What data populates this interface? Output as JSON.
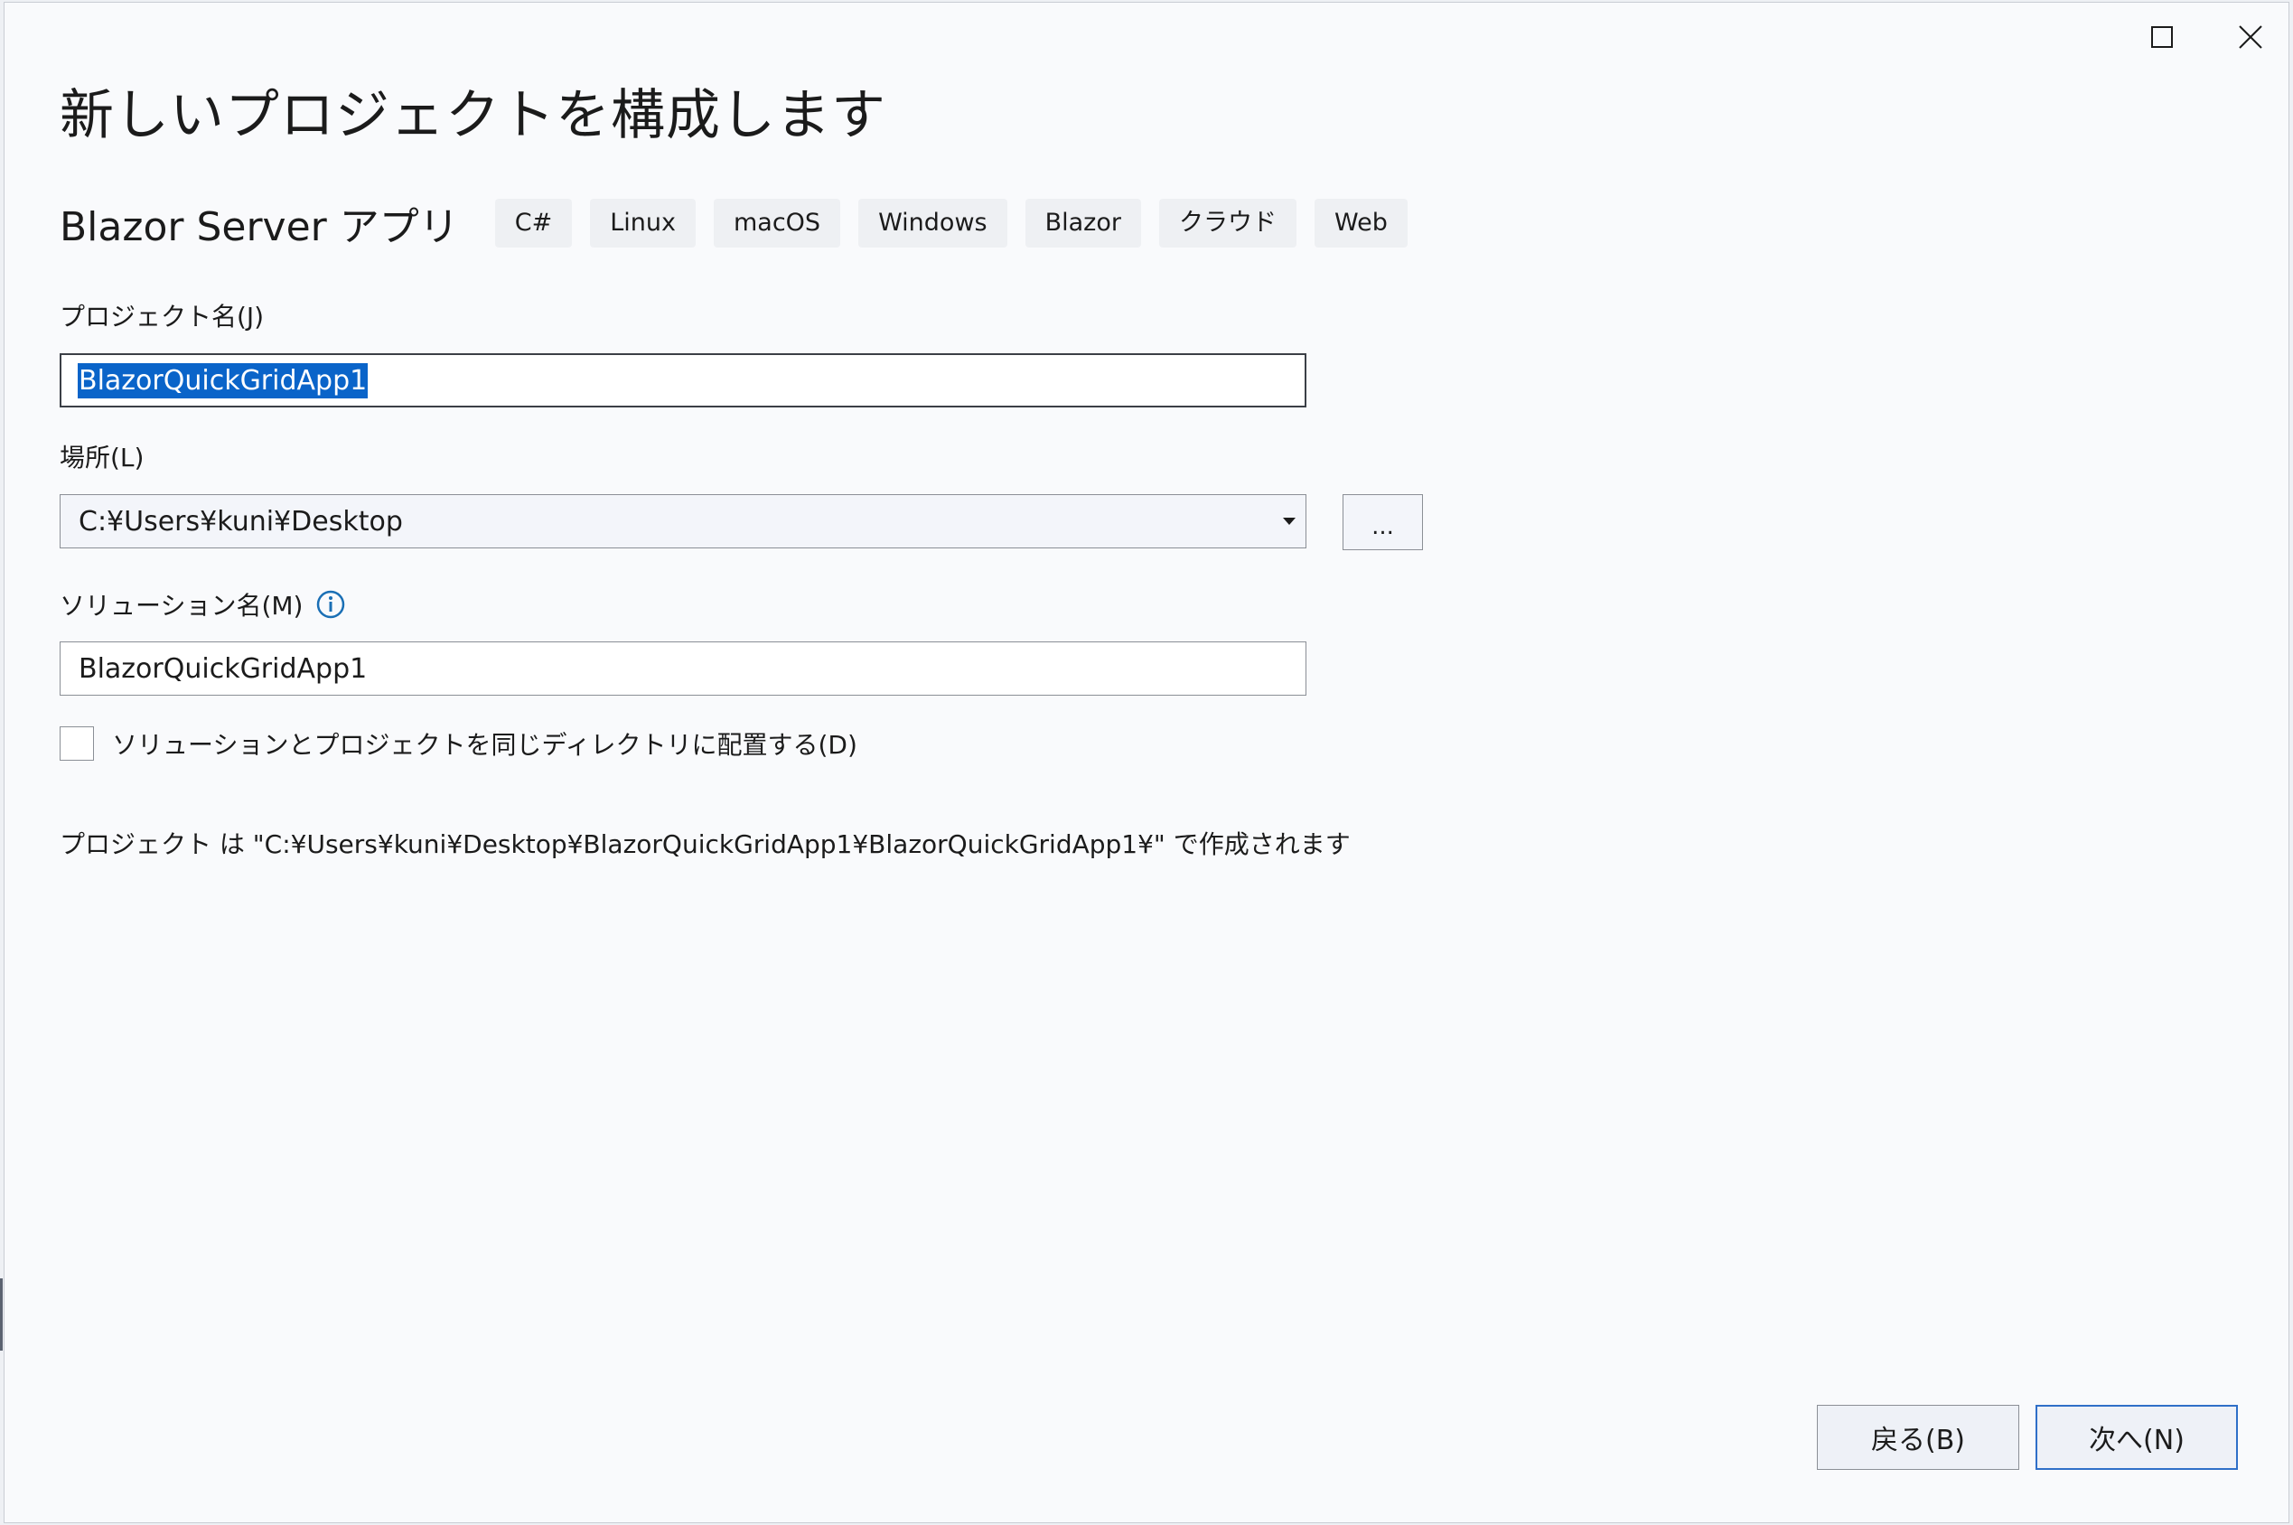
{
  "window": {
    "title": "新しいプロジェクトを構成します",
    "maximize_icon": "maximize-icon",
    "close_icon": "close-icon"
  },
  "template": {
    "name": "Blazor Server アプリ",
    "tags": [
      "C#",
      "Linux",
      "macOS",
      "Windows",
      "Blazor",
      "クラウド",
      "Web"
    ]
  },
  "project_name": {
    "label": "プロジェクト名(J)",
    "value": "BlazorQuickGridApp1"
  },
  "location": {
    "label": "場所(L)",
    "value": "C:¥Users¥kuni¥Desktop",
    "browse_label": "..."
  },
  "solution_name": {
    "label": "ソリューション名(M)",
    "value": "BlazorQuickGridApp1",
    "info_icon": "info-icon"
  },
  "same_directory": {
    "label": "ソリューションとプロジェクトを同じディレクトリに配置する(D)",
    "checked": false
  },
  "path_info": "プロジェクト は \"C:¥Users¥kuni¥Desktop¥BlazorQuickGridApp1¥BlazorQuickGridApp1¥\" で作成されます",
  "footer": {
    "back_label": "戻る(B)",
    "next_label": "次へ(N)"
  },
  "colors": {
    "accent": "#0a64c9",
    "info": "#1a6fb5"
  }
}
